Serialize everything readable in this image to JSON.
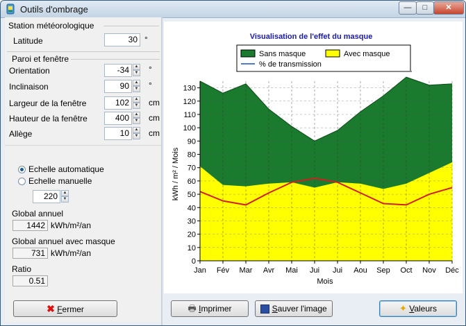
{
  "window": {
    "title": "Outils d'ombrage"
  },
  "meteo": {
    "group": "Station météorologique",
    "latitude_label": "Latitude",
    "latitude_value": "30",
    "latitude_unit": "°"
  },
  "paroi": {
    "group": "Paroi et fenêtre",
    "orientation_label": "Orientation",
    "orientation_value": "-34",
    "orientation_unit": "°",
    "inclinaison_label": "Inclinaison",
    "inclinaison_value": "90",
    "inclinaison_unit": "°",
    "largeur_label": "Largeur de la fenêtre",
    "largeur_value": "102",
    "largeur_unit": "cm",
    "hauteur_label": "Hauteur de la fenêtre",
    "hauteur_value": "400",
    "hauteur_unit": "cm",
    "allege_label": "Allège",
    "allege_value": "10",
    "allege_unit": "cm"
  },
  "scale": {
    "auto_label": "Echelle automatique",
    "manual_label": "Echelle manuelle",
    "manual_value": "220",
    "selected": "auto"
  },
  "results": {
    "global_label": "Global annuel",
    "global_value": "1442",
    "global_unit": "kWh/m²/an",
    "masque_label": "Global annuel avec masque",
    "masque_value": "731",
    "masque_unit": "kWh/m²/an",
    "ratio_label": "Ratio",
    "ratio_value": "0.51"
  },
  "buttons": {
    "fermer_u": "F",
    "fermer_rest": "ermer",
    "imprimer_u": "I",
    "imprimer_rest": "mprimer",
    "sauver_u": "S",
    "sauver_rest": "auver l'image",
    "valeurs_u": "V",
    "valeurs_rest": "aleurs"
  },
  "chart_data": {
    "type": "area",
    "title": "Visualisation de l'effet du masque",
    "xlabel": "Mois",
    "ylabel": "kWh / m² / Mois",
    "ylim": [
      0,
      135
    ],
    "yticks": [
      0,
      10,
      20,
      30,
      40,
      50,
      60,
      70,
      80,
      90,
      100,
      110,
      120,
      130
    ],
    "categories": [
      "Jan",
      "Fév",
      "Mar",
      "Avr",
      "Mai",
      "Jui",
      "Jui",
      "Aou",
      "Sep",
      "Oct",
      "Nov",
      "Déc"
    ],
    "grid": true,
    "legend_position": "top",
    "colors": {
      "sans": "#1a7a2e",
      "avec": "#ffff00",
      "transmission": "#d02020"
    },
    "series": [
      {
        "name": "Sans masque",
        "values": [
          135,
          126,
          133,
          114,
          101,
          90,
          98,
          112,
          124,
          138,
          132,
          133
        ]
      },
      {
        "name": "Avec masque",
        "values": [
          71,
          57,
          56,
          58,
          59,
          55,
          59,
          58,
          54,
          58,
          66,
          74
        ]
      },
      {
        "name": "% de transmission",
        "values": [
          52,
          45,
          42,
          51,
          59,
          62,
          59,
          51,
          43,
          42,
          50,
          55
        ]
      }
    ]
  }
}
